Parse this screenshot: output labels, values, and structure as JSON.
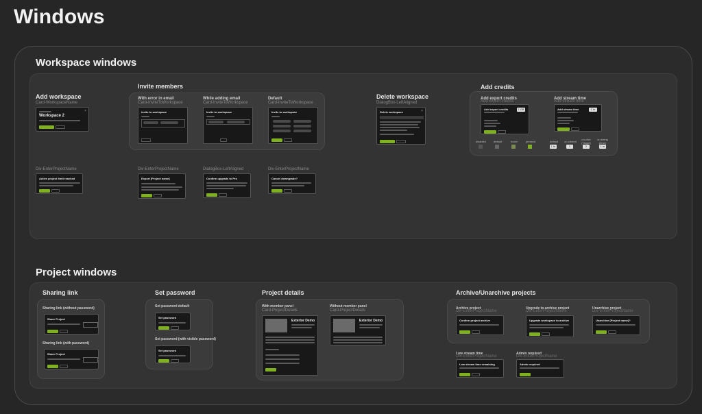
{
  "page": {
    "title": "Windows"
  },
  "workspace": {
    "title": "Workspace windows",
    "add_workspace": {
      "title": "Add workspace",
      "component": "Card-WorkspaceName",
      "frame_title": "Workspace 2"
    },
    "invite_members": {
      "title": "Invite members",
      "variants": [
        {
          "caption": "With error in email",
          "component": "Card-InviteToWorkspace",
          "frame_title": "Invite to workspace"
        },
        {
          "caption": "While adding email",
          "component": "Card-InviteToWorkspace",
          "frame_title": "Invite to workspace"
        },
        {
          "caption": "Default",
          "component": "Card-InviteToWorkspace",
          "frame_title": "Invite to workspace"
        }
      ]
    },
    "delete_workspace": {
      "title": "Delete workspace",
      "component": "DialogBox-LeftAligned",
      "frame_title": "Delete workspace"
    },
    "add_credits": {
      "title": "Add credits",
      "left": {
        "caption": "Add export credits",
        "component": "Add export credits",
        "frame_title": "Add export credits",
        "qty": "1 GB",
        "states": [
          "disabled",
          "default",
          "hover",
          "pressed"
        ]
      },
      "right": {
        "caption": "Add stream time",
        "component": "Add stream time",
        "frame_title": "Add stream time",
        "qty": "1 hr",
        "states": [
          "default",
          "on-clicked",
          "on-click (Target)",
          "on-being (time)"
        ],
        "state_values": [
          "1 hr",
          "1",
          "2",
          "1 hr"
        ]
      }
    },
    "row2": [
      {
        "component": "Div-EnterProjectName",
        "frame_title": "Active project limit reached"
      },
      {
        "component": "Div-EnterProjectName",
        "frame_title": "Export [Project name]"
      },
      {
        "component": "DialogBox-LeftAligned",
        "frame_title": "Confirm upgrade to Pro"
      },
      {
        "component": "Div-EnterProjectName",
        "frame_title": "Cancel downgrade?"
      }
    ]
  },
  "project": {
    "title": "Project windows",
    "sharing_link": {
      "title": "Sharing link",
      "items": [
        {
          "caption": "Sharing link (without password)",
          "frame_title": "Share Project"
        },
        {
          "caption": "Sharing link (with password)",
          "frame_title": "Share Project"
        }
      ]
    },
    "set_password": {
      "title": "Set password",
      "items": [
        {
          "caption": "Set password default",
          "frame_title": "Set password"
        },
        {
          "caption": "Set password (with visible password)",
          "frame_title": "Set password"
        }
      ]
    },
    "project_details": {
      "title": "Project details",
      "items": [
        {
          "caption": "With member panel",
          "component": "Card-ProjectDetails",
          "frame_title": "Exterior Demo"
        },
        {
          "caption": "Without member panel",
          "component": "Card-ProjectDetails",
          "frame_title": "Exterior Demo"
        }
      ]
    },
    "archive": {
      "title": "Archive/Unarchive projects",
      "items": [
        {
          "caption": "Archive project",
          "component": "Div-EnterProjectName",
          "frame_title": "Confirm project archive"
        },
        {
          "caption": "Upgrade to archive project",
          "component": "Div-EnterProjectName",
          "frame_title": "Upgrade workspace to archive"
        },
        {
          "caption": "Unarchive project",
          "component": "Div-EnterProjectName",
          "frame_title": "Unarchive [Project name]?"
        }
      ],
      "below": [
        {
          "caption": "Low stream time",
          "component": "Div-EnterProjectName",
          "frame_title": "Low stream time remaining"
        },
        {
          "caption": "Admin required",
          "component": "Div-EnterProjectName",
          "frame_title": "Admin required"
        }
      ]
    }
  },
  "colors": {
    "accent": "#7fb01f",
    "background": "#262626"
  }
}
